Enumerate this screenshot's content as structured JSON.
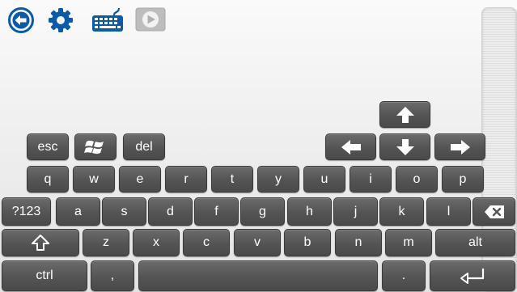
{
  "toolbar": {
    "back_icon": "back-arrow-circle-icon",
    "settings_icon": "gear-icon",
    "keyboard_icon": "keyboard-icon",
    "play_icon": "play-icon"
  },
  "colors": {
    "toolbar_blue": "#0a5aa8",
    "key_face": "#555555",
    "key_text": "#ffffff",
    "play_gray": "#b7b7b7"
  },
  "keyboard": {
    "row_special": {
      "esc": "esc",
      "del": "del",
      "windows_icon": "windows-logo-icon"
    },
    "arrows": {
      "up": "arrow-up-icon",
      "left": "arrow-left-icon",
      "down": "arrow-down-icon",
      "right": "arrow-right-icon"
    },
    "row1": [
      "q",
      "w",
      "e",
      "r",
      "t",
      "y",
      "u",
      "i",
      "o",
      "p"
    ],
    "row2": [
      "?123",
      "a",
      "s",
      "d",
      "f",
      "g",
      "h",
      "j",
      "k",
      "l"
    ],
    "row3": [
      "z",
      "x",
      "c",
      "v",
      "b",
      "n",
      "m",
      "alt"
    ],
    "row4": {
      "ctrl": "ctrl",
      "comma": ",",
      "period": "."
    },
    "icons": {
      "backspace": "backspace-icon",
      "shift": "shift-icon",
      "enter": "enter-icon"
    }
  }
}
